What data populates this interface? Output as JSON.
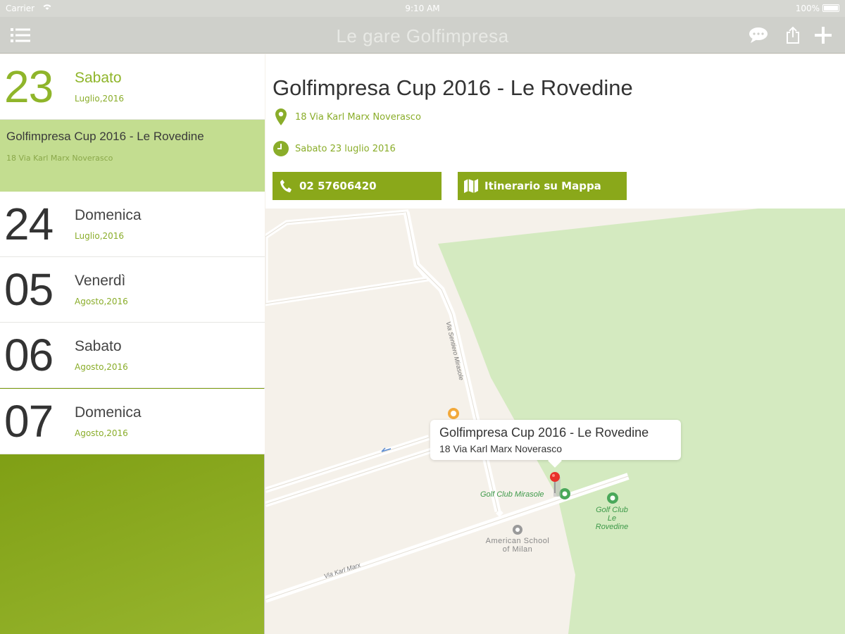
{
  "status_bar": {
    "carrier": "Carrier",
    "time": "9:10 AM",
    "battery": "100%"
  },
  "nav": {
    "title": "Le gare Golfimpresa",
    "icons": [
      "menu-icon",
      "chat-icon",
      "share-icon",
      "add-icon"
    ]
  },
  "days": [
    {
      "num": "23",
      "name": "Sabato",
      "month": "Luglio,2016",
      "selected": true
    },
    {
      "num": "24",
      "name": "Domenica",
      "month": "Luglio,2016"
    },
    {
      "num": "05",
      "name": "Venerdì",
      "month": "Agosto,2016"
    },
    {
      "num": "06",
      "name": "Sabato",
      "month": "Agosto,2016"
    },
    {
      "num": "07",
      "name": "Domenica",
      "month": "Agosto,2016"
    }
  ],
  "selected_event": {
    "title": "Golfimpresa Cup 2016 - Le Rovedine",
    "address": "18 Via Karl Marx Noverasco"
  },
  "detail": {
    "title": "Golfimpresa Cup 2016 - Le Rovedine",
    "address": "18 Via Karl Marx Noverasco",
    "date": "Sabato 23 luglio 2016",
    "phone": "02 57606420",
    "map_button": "Itinerario su Mappa"
  },
  "map": {
    "callout_title": "Golfimpresa Cup 2016 - Le Rovedine",
    "callout_subtitle": "18 Via Karl Marx Noverasco",
    "poi_golf_club_mirasole": "Golf Club Mirasole",
    "poi_golf_club_rovedine_1": "Golf Club",
    "poi_golf_club_rovedine_2": "Le Rovedine",
    "poi_school_1": "American School",
    "poi_school_2": "of Milan",
    "street_karl_marx": "Via Karl Marx",
    "street_santa_mirasole": "Via Sentiero Mirasole"
  },
  "colors": {
    "accent": "#8aa81a",
    "accent_light": "#c3dd90",
    "map_green": "#d4eac0",
    "map_land": "#f5f1ea"
  }
}
